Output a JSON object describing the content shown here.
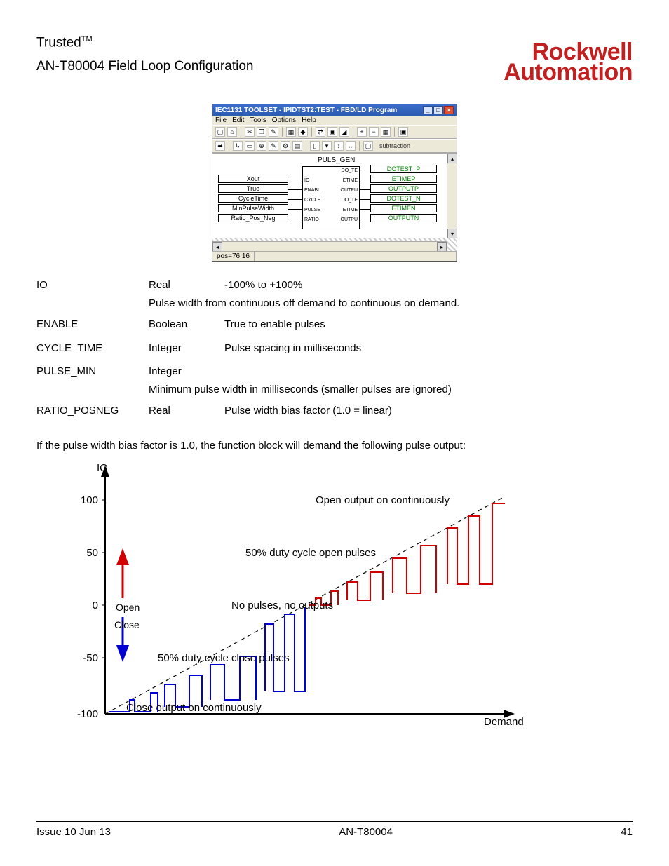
{
  "header": {
    "trusted": "Trusted",
    "tm": "TM",
    "subtitle": "AN-T80004 Field Loop Configuration",
    "logo_line1": "Rockwell",
    "logo_line2": "Automation"
  },
  "window": {
    "title": "IEC1131 TOOLSET - IPIDTST2:TEST - FBD/LD Program",
    "menus": [
      "File",
      "Edit",
      "Tools",
      "Options",
      "Help"
    ],
    "toolbar_search_label": "subtraction",
    "block_title": "PULS_GEN",
    "block_ports_left": [
      "DO_TE",
      "IO",
      "ETIME",
      "ENABL",
      "OUTPU",
      "CYCLE",
      "DO_TE",
      "PULSE",
      "ETIME",
      "RATIO",
      "OUTPU"
    ],
    "inputs": [
      "Xout",
      "True",
      "CycleTime",
      "MinPulseWidth",
      "Ratio_Pos_Neg"
    ],
    "outputs": [
      "DOTEST_P",
      "ETIMEP",
      "OUTPUTP",
      "DOTEST_N",
      "ETIMEN",
      "OUTPUTN"
    ],
    "status": "pos=76,16"
  },
  "params": [
    {
      "name": "IO",
      "type": "Real",
      "desc": "-100% to +100%",
      "note": "Pulse width from continuous off demand to continuous on demand."
    },
    {
      "name": "ENABLE",
      "type": "Boolean",
      "desc": "True to enable pulses"
    },
    {
      "name": "CYCLE_TIME",
      "type": "Integer",
      "desc": "Pulse spacing in milliseconds"
    },
    {
      "name": "PULSE_MIN",
      "type": "Integer",
      "desc": "",
      "note": "Minimum pulse width in milliseconds (smaller pulses are ignored)"
    },
    {
      "name": "RATIO_POSNEG",
      "type": "Real",
      "desc": "Pulse width bias factor (1.0 = linear)"
    }
  ],
  "bodytext": "If the pulse width bias factor is 1.0, the function block will demand the following pulse output:",
  "chart_data": {
    "type": "line",
    "ylabel": "IO",
    "xlabel": "Demand",
    "y_ticks": [
      -100.0,
      -50.0,
      0.0,
      50.0,
      100.0
    ],
    "series": [
      {
        "name": "demand-dashed",
        "values": "linear -100 to +100 dashed guide"
      },
      {
        "name": "open-pulses",
        "color": "red",
        "behavior": "positive-side pulse train, duty increasing to 100% at IO=+100"
      },
      {
        "name": "close-pulses",
        "color": "blue",
        "behavior": "negative-side pulse train, duty increasing to 100% at IO=-100"
      }
    ],
    "annotations": [
      {
        "text": "Open output on continuously",
        "y": 100
      },
      {
        "text": "50% duty cycle open pulses",
        "y": 50
      },
      {
        "text": "No pulses, no outputs",
        "y": 0
      },
      {
        "text": "50% duty cycle close pulses",
        "y": -50
      },
      {
        "text": "Close output on continuously",
        "y": -100
      }
    ],
    "arrows": [
      {
        "label": "Open",
        "color": "red",
        "direction": "up"
      },
      {
        "label": "Close",
        "color": "blue",
        "direction": "down"
      }
    ]
  },
  "footer": {
    "left": "Issue 10 Jun 13",
    "center": "AN-T80004",
    "right": "41"
  }
}
